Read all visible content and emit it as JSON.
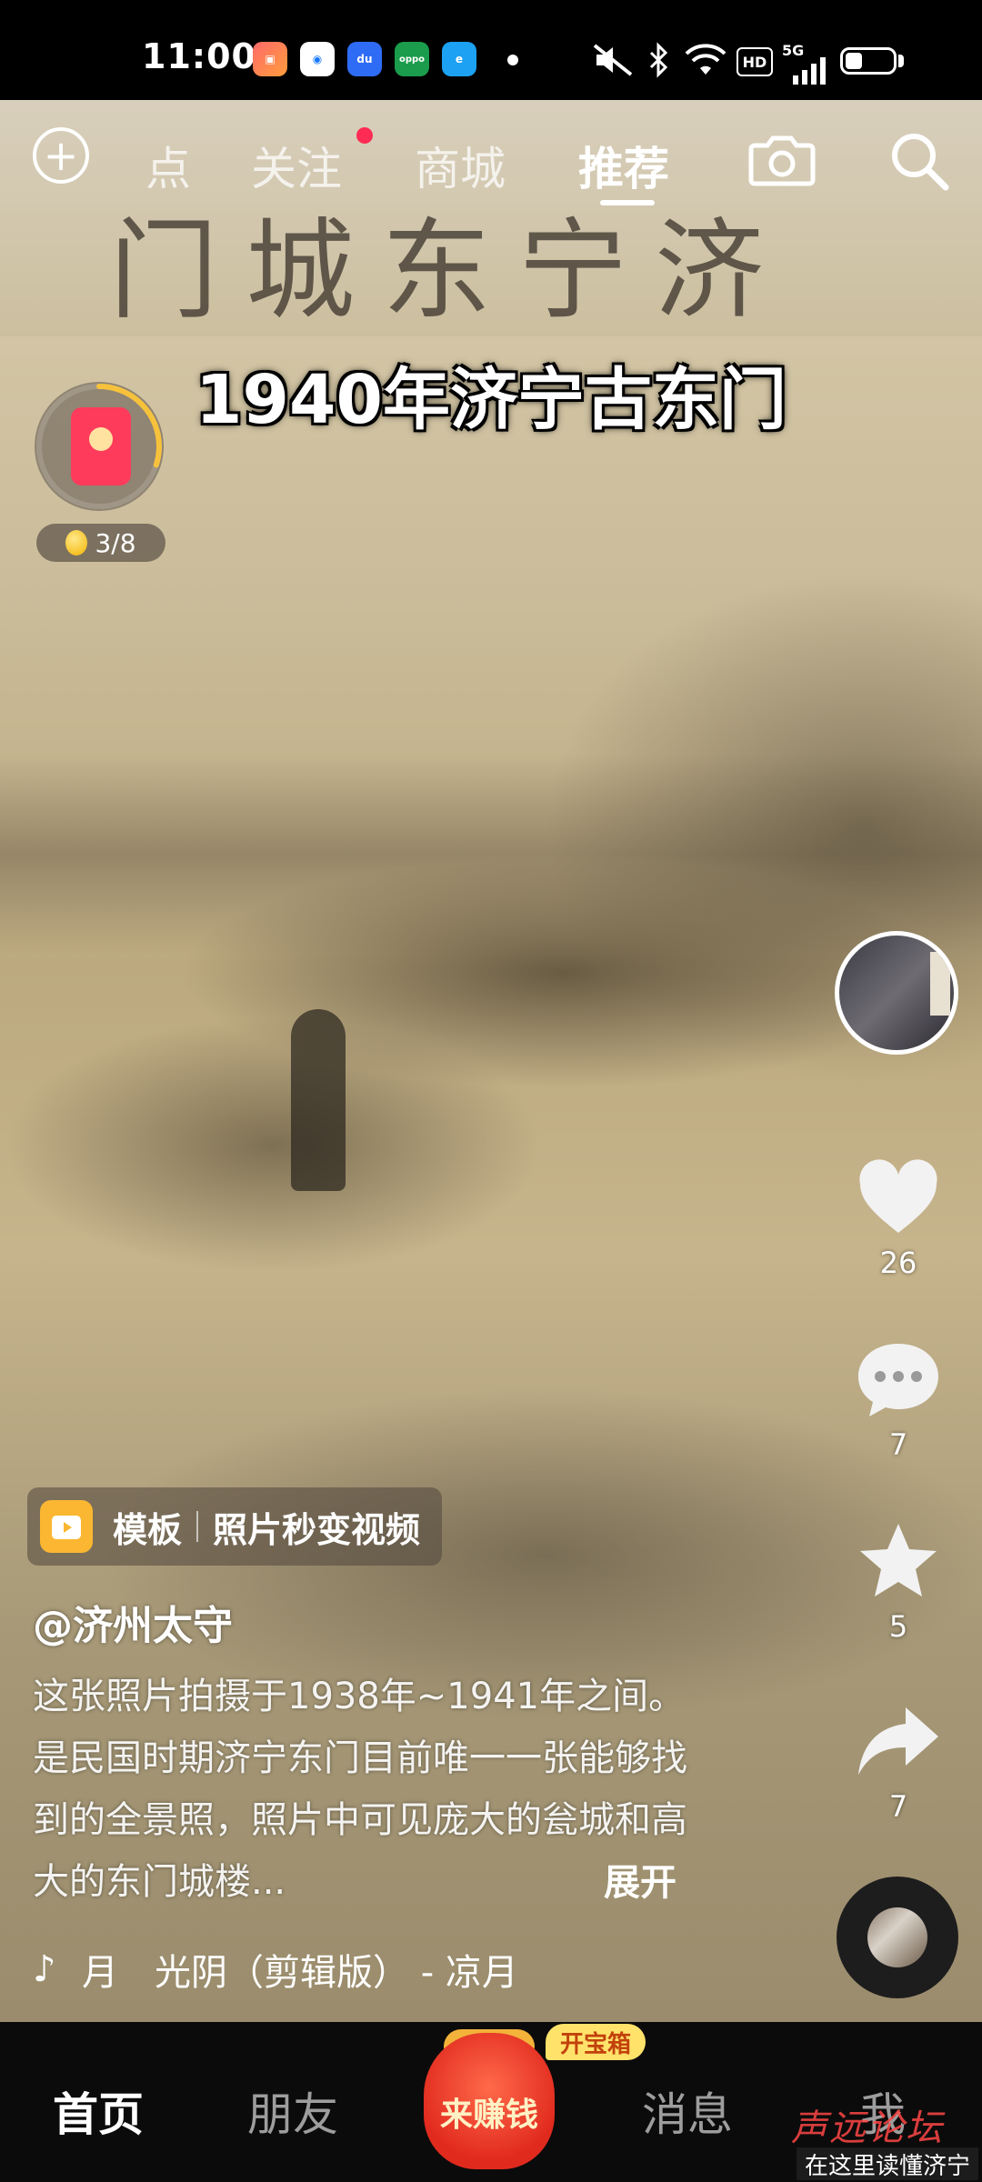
{
  "status_bar": {
    "time": "11:00",
    "apps": [
      "photo-app-icon",
      "browser-app-icon",
      "baidu-app-icon",
      "oppo-app-icon",
      "edge-app-icon"
    ],
    "oppo_label": "oppo",
    "network_hd": "HD",
    "network_type": "5G",
    "battery_level": 0.35
  },
  "top_nav": {
    "tabs": [
      "点",
      "关注",
      "商城",
      "推荐"
    ],
    "active_tab": "推荐",
    "follow_has_dot": true
  },
  "video": {
    "overlay_title": "1940年济宁古东门",
    "gate_inscription": "门城东宁济"
  },
  "redpack_widget": {
    "progress": 0.3,
    "coin_count": "3/8"
  },
  "right_rail": {
    "likes": "26",
    "comments": "7",
    "favorites": "5",
    "shares": "7"
  },
  "template_chip": {
    "label": "模板",
    "text": "照片秒变视频"
  },
  "post": {
    "author": "@济州太守",
    "caption": "这张照片拍摄于1938年~1941年之间。是民国时期济宁东门目前唯一一张能够找到的全景照，照片中可见庞大的瓮城和高大的东门城楼...",
    "expand_label": "展开",
    "music": "月　光阴（剪辑版） - 凉月"
  },
  "bottom_nav": {
    "home": "首页",
    "friends": "朋友",
    "earn": "来赚钱",
    "treasure": "开宝箱",
    "messages": "消息",
    "me": "我"
  },
  "watermark": {
    "brand": "声远论坛",
    "slogan": "在这里读懂济宁"
  }
}
